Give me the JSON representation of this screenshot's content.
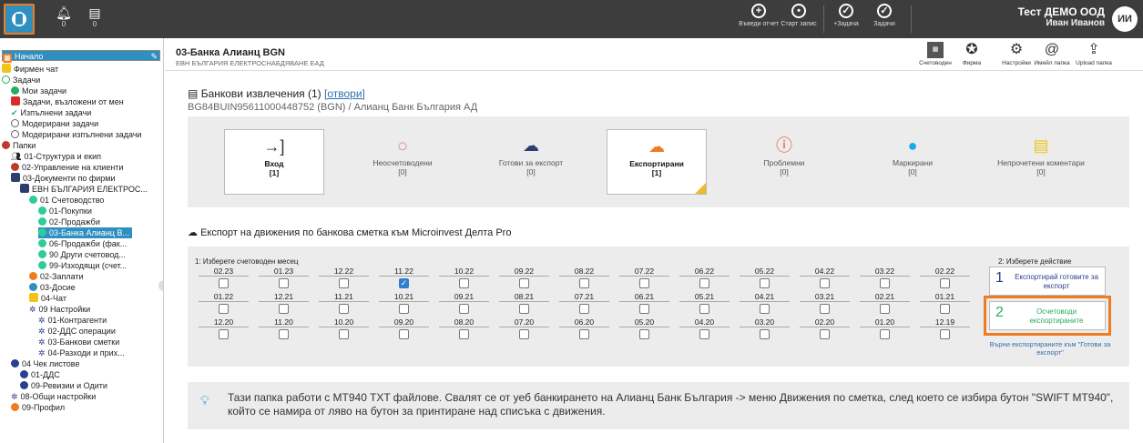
{
  "topbar": {
    "notify_count": "0",
    "chat_count": "0",
    "actions": [
      {
        "icon": "plus-circle-icon",
        "label": "Въведи отчет"
      },
      {
        "icon": "record-circle-icon",
        "label": "Старт запис"
      },
      {
        "icon": "add-task-icon",
        "label": "+Задача"
      },
      {
        "icon": "check-circle-icon",
        "label": "Задачи"
      }
    ],
    "company": "Тест ДЕМО ООД",
    "user": "Иван Иванов",
    "avatar_initials": "ИИ"
  },
  "sidebar": {
    "items": [
      {
        "label": "Начало"
      },
      {
        "label": "Фирмен чат"
      },
      {
        "label": "Задачи"
      },
      {
        "label": "Мои задачи"
      },
      {
        "label": "Задачи, възложени от мен"
      },
      {
        "label": "Изпълнени задачи"
      },
      {
        "label": "Модерирани задачи"
      },
      {
        "label": "Модерирани изпълнени задачи"
      },
      {
        "label": "Папки"
      },
      {
        "label": "01-Структура и екип"
      },
      {
        "label": "02-Управление на клиенти"
      },
      {
        "label": "03-Документи по фирми"
      },
      {
        "label": "ЕВН БЪЛГАРИЯ ЕЛЕКТРОС..."
      },
      {
        "label": "01 Счетоводство"
      },
      {
        "label": "01-Покупки"
      },
      {
        "label": "02-Продажби"
      },
      {
        "label": "03-Банка Алианц В..."
      },
      {
        "label": "06-Продажби (фак..."
      },
      {
        "label": "90 Други счетовод..."
      },
      {
        "label": "99-Изходящи (счет..."
      },
      {
        "label": "02-Заплати"
      },
      {
        "label": "03-Досие"
      },
      {
        "label": "04-Чат"
      },
      {
        "label": "09 Настройки"
      },
      {
        "label": "01-Контрагенти"
      },
      {
        "label": "02-ДДС операции"
      },
      {
        "label": "03-Банкови сметки"
      },
      {
        "label": "04-Разходи и прих..."
      },
      {
        "label": "04 Чек листове"
      },
      {
        "label": "01-ДДС"
      },
      {
        "label": "09-Ревизии и Одити"
      },
      {
        "label": "08-Общи настройки"
      },
      {
        "label": "09-Профил"
      }
    ]
  },
  "header": {
    "title": "03-Банка Алианц BGN",
    "subtitle": "ЕВН БЪЛГАРИЯ ЕЛЕКТРОСНАБДЯВАНЕ ЕАД",
    "tools": [
      {
        "label": "Счетоводен"
      },
      {
        "label": "Фирма"
      },
      {
        "label": "Настройки"
      },
      {
        "label": "Имейл папка"
      },
      {
        "label": "Upload папка"
      }
    ]
  },
  "main": {
    "section_title": "Банкови извлечения (1)",
    "open_link": "[отвори]",
    "iban": "BG84BUIN95611000448752 (BGN) / Алианц Банк България АД",
    "cards": [
      {
        "title": "Вход",
        "count": "[1]",
        "color": "#333333"
      },
      {
        "title": "Неосчетоводени",
        "count": "[0]",
        "color": "#c0392b"
      },
      {
        "title": "Готови за експорт",
        "count": "[0]",
        "color": "#2c3e70"
      },
      {
        "title": "Експортирани",
        "count": "[1]",
        "color": "#f07b20"
      },
      {
        "title": "Проблемни",
        "count": "[0]",
        "color": "#e74c3c"
      },
      {
        "title": "Маркирани",
        "count": "[0]",
        "color": "#1fa6e8"
      },
      {
        "title": "Непрочетени коментари",
        "count": "[0]",
        "color": "#f0c419"
      }
    ],
    "export_title": "Експорт на движения по банкова сметка към Microinvest Делта Pro",
    "month_label": "1: Изберете счетоводен месец",
    "action_label": "2: Изберете действие",
    "months": [
      [
        "02.23",
        "01.23",
        "12.22",
        "11.22",
        "10.22",
        "09.22",
        "08.22",
        "07.22",
        "06.22",
        "05.22",
        "04.22",
        "03.22",
        "02.22"
      ],
      [
        "01.22",
        "12.21",
        "11.21",
        "10.21",
        "09.21",
        "08.21",
        "07.21",
        "06.21",
        "05.21",
        "04.21",
        "03.21",
        "02.21",
        "01.21"
      ],
      [
        "12.20",
        "11.20",
        "10.20",
        "09.20",
        "08.20",
        "07.20",
        "06.20",
        "05.20",
        "04.20",
        "03.20",
        "02.20",
        "01.20",
        "12.19"
      ]
    ],
    "checked_month": "11.22",
    "actions": [
      {
        "num": "1",
        "label": "Експортирай готовите за експорт",
        "color": "#2c3e90"
      },
      {
        "num": "2",
        "label": "Осчетоводи експортираните",
        "color": "#27ae60"
      }
    ],
    "return_link": "Върни експортираните към \"Готови за експорт\"",
    "info_text": "Тази папка работи с MT940 TXT файлове. Свалят се от уеб банкирането на Алианц Банк България -> меню Движения по сметка, след което се избира бутон \"SWIFT MT940\", който се намира от ляво на бутон за принтиране над списъка с движения."
  }
}
